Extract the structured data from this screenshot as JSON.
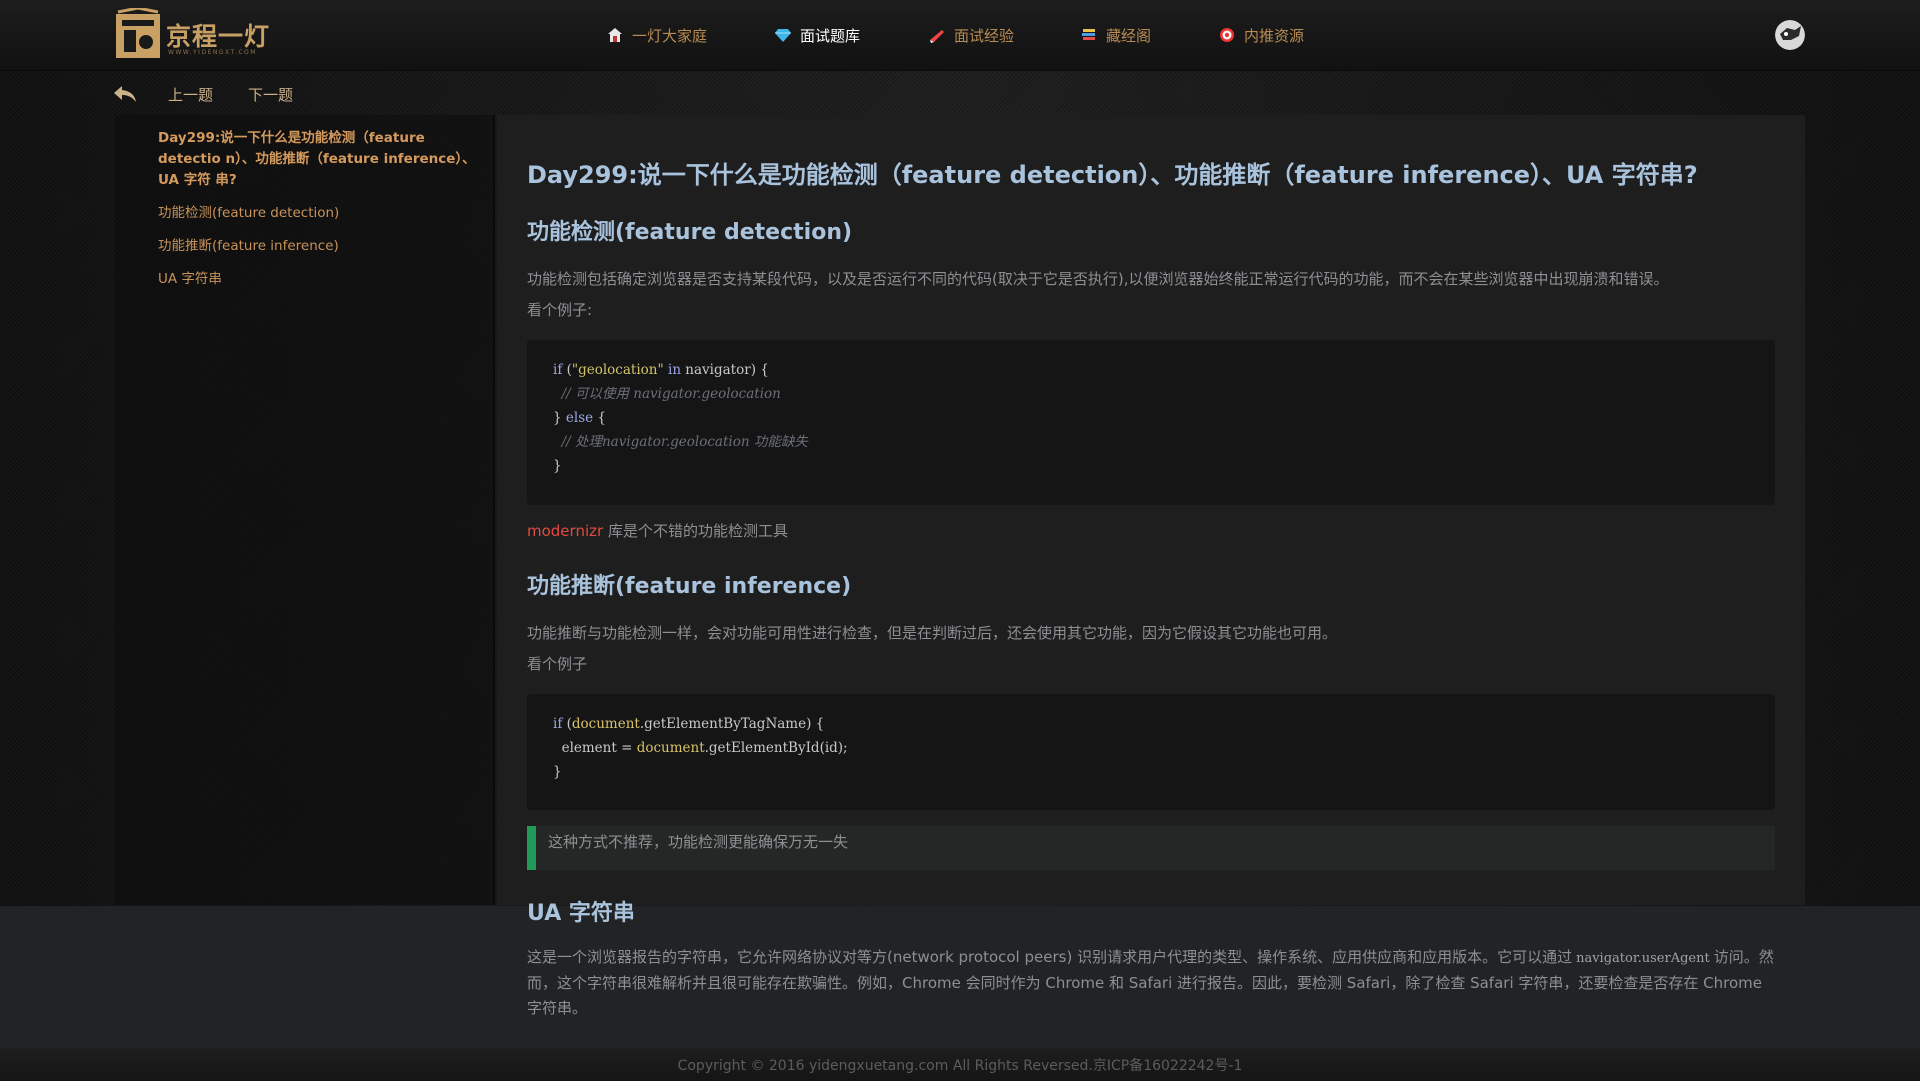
{
  "header": {
    "logo_text": "京程一灯",
    "logo_sub": "WWW.YIDENGXT.COM",
    "nav": [
      {
        "label": "一灯大家庭",
        "icon": "home-icon"
      },
      {
        "label": "面试题库",
        "icon": "diamond-icon",
        "active": true
      },
      {
        "label": "面试经验",
        "icon": "rocket-icon"
      },
      {
        "label": "藏经阁",
        "icon": "books-icon"
      },
      {
        "label": "内推资源",
        "icon": "target-icon"
      }
    ]
  },
  "subnav": {
    "prev": "上一题",
    "next": "下一题"
  },
  "sidebar": {
    "items": [
      "Day299:说一下什么是功能检测（feature detectio n）、功能推断（feature inference）、UA 字符 串?",
      "功能检测(feature detection)",
      "功能推断(feature inference)",
      "UA 字符串"
    ]
  },
  "article": {
    "title": "Day299:说一下什么是功能检测（feature detection）、功能推断（feature inference）、UA 字符串?",
    "sec1_heading": "功能检测(feature detection)",
    "sec1_para": "功能检测包括确定浏览器是否支持某段代码，以及是否运行不同的代码(取决于它是否执行),以便浏览器始终能正常运行代码的功能，而不会在某些浏览器中出现崩溃和错误。",
    "sec1_example": "看个例子:",
    "code1": {
      "l1_kw": "if",
      "l1_a": " (",
      "l1_str": "\"geolocation\"",
      "l1_b": " ",
      "l1_in": "in",
      "l1_c": " navigator) {",
      "l2": "  // 可以使用 navigator.geolocation",
      "l3_a": "} ",
      "l3_kw": "else",
      "l3_b": " {",
      "l4": "  // 处理navigator.geolocation 功能缺失",
      "l5": "}"
    },
    "modernizr_link": "modernizr",
    "modernizr_text": " 库是个不错的功能检测工具",
    "sec2_heading": "功能推断(feature inference)",
    "sec2_para": "功能推断与功能检测一样，会对功能可用性进行检查，但是在判断过后，还会使用其它功能，因为它假设其它功能也可用。",
    "sec2_example": "看个例子",
    "code2": {
      "l1_kw": "if",
      "l1_a": " (",
      "l1_obj": "document",
      "l1_b": ".getElementByTagName) {",
      "l2_a": "  element = ",
      "l2_obj": "document",
      "l2_b": ".getElementById(id);",
      "l3": "}"
    },
    "quote": "这种方式不推荐，功能检测更能确保万无一失",
    "sec3_heading": "UA 字符串",
    "sec3_para_a": "这是一个浏览器报告的字符串，它允许网络协议对等方(network protocol peers) 识别请求用户代理的类型、操作系统、应用供应商和应用版本。它可以通过",
    "sec3_code": "navigator.userAgent",
    "sec3_para_b": "访问。然而，这个字符串很难解析并且很可能存在欺骗性。例如，Chrome 会同时作为 Chrome 和 Safari 进行报告。因此，要检测 Safari，除了检查 Safari 字符串，还要检查是否存在 Chrome 字符串。"
  },
  "footer": {
    "copyright": "Copyright © 2016 yidengxuetang.com All Rights Reversed.京ICP备16022242号-1"
  },
  "colors": {
    "accent": "#b88b52",
    "heading": "#a9c3dd",
    "link": "#e24b41",
    "quote_bar": "#1f9a58"
  }
}
